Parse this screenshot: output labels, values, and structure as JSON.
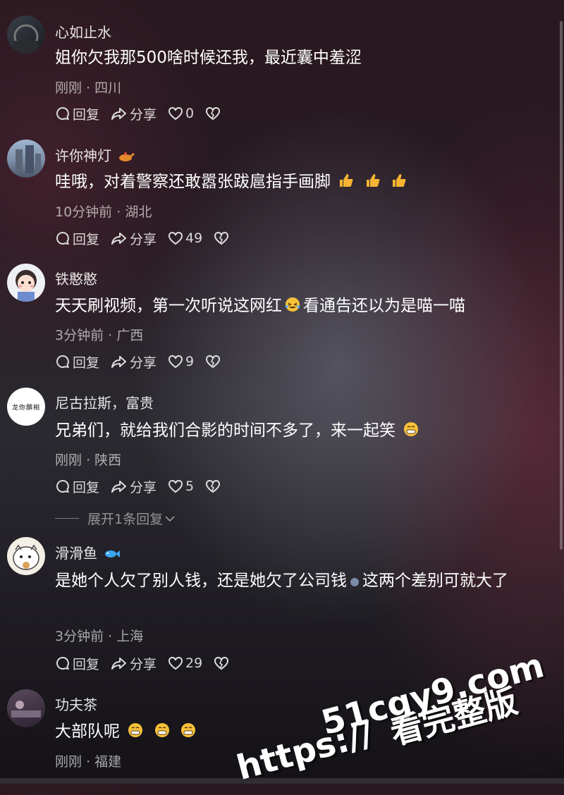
{
  "comments": [
    {
      "user": "心如止水",
      "text": "姐你欠我那500啥时候还我，最近囊中羞涩",
      "time": "刚刚",
      "location": "四川",
      "reply_label": "回复",
      "share_label": "分享",
      "likes": "0"
    },
    {
      "user": "许你神灯",
      "text": "哇哦，对着警察还敢嚣张跋扈指手画脚",
      "time": "10分钟前",
      "location": "湖北",
      "reply_label": "回复",
      "share_label": "分享",
      "likes": "49"
    },
    {
      "user": "铁憨憨",
      "text_a": "天天刷视频，第一次听说这网红",
      "text_b": "看通告还以为是喵一喵",
      "time": "3分钟前",
      "location": "广西",
      "reply_label": "回复",
      "share_label": "分享",
      "likes": "9"
    },
    {
      "user": "尼古拉斯，富贵",
      "avatar_text": "龙你願相",
      "text": "兄弟们，就给我们合影的时间不多了，来一起笑",
      "time": "刚刚",
      "location": "陕西",
      "reply_label": "回复",
      "share_label": "分享",
      "likes": "5",
      "expand_label": "展开1条回复"
    },
    {
      "user": "滑滑鱼",
      "text_a": "是她个人欠了别人钱，还是她欠了公司钱",
      "text_b": "这两个差别可就大了",
      "time": "3分钟前",
      "location": "上海",
      "reply_label": "回复",
      "share_label": "分享",
      "likes": "29"
    },
    {
      "user": "功夫茶",
      "text": "大部队呢",
      "time": "刚刚",
      "location": "福建"
    }
  ],
  "watermark": {
    "url": "https://51cgy9.com",
    "line1": "51cgy9.com",
    "line2a": "https://",
    "line2b": "看完整版"
  },
  "colors": {
    "like_heart": "#ffffff",
    "thumbs": "#f5b431",
    "emoji_face": "#f7c23a"
  },
  "icons": [
    "comment-bubble-icon",
    "share-arrow-icon",
    "heart-icon",
    "broken-heart-icon",
    "thumbs-up-emoji",
    "laughing-emoji",
    "grin-emoji",
    "lamp-emoji",
    "fish-emoji"
  ]
}
